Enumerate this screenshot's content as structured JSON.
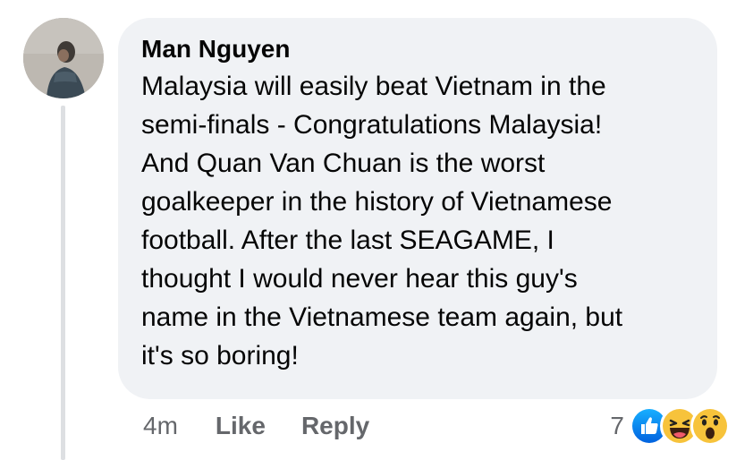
{
  "comment": {
    "author": "Man Nguyen",
    "body": "Malaysia will easily beat Vietnam in the\nsemi-finals - Congratulations Malaysia!\nAnd Quan Van Chuan is the worst\ngoalkeeper in the history of Vietnamese\nfootball. After the last SEAGAME, I\nthought I would never hear this guy's\nname in the Vietnamese team again, but\nit's so boring!",
    "timestamp": "4m",
    "like_label": "Like",
    "reply_label": "Reply"
  },
  "reactions": {
    "count": "7",
    "icons": [
      "like-reaction-icon",
      "haha-reaction-icon",
      "wow-reaction-icon"
    ]
  },
  "colors": {
    "bubble_bg": "#f0f2f5",
    "text": "#050505",
    "secondary_text": "#65676b",
    "like_blue": "#1877f2",
    "emoji_yellow": "#f7c33b"
  }
}
